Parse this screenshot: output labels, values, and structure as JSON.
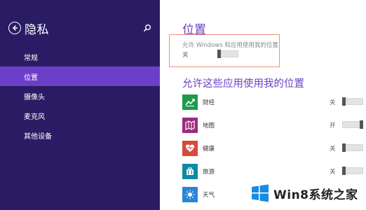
{
  "sidebar": {
    "title": "隐私",
    "items": [
      {
        "label": "常规",
        "active": false
      },
      {
        "label": "位置",
        "active": true
      },
      {
        "label": "摄像头",
        "active": false
      },
      {
        "label": "麦克风",
        "active": false
      },
      {
        "label": "其他设备",
        "active": false
      }
    ]
  },
  "main": {
    "heading": "位置",
    "master_toggle": {
      "description": "允许 Windows 和应用使用我的位置",
      "state": "关",
      "value": false
    },
    "apps_heading": "允许这些应用使用我的位置",
    "apps": [
      {
        "name": "财经",
        "state": "关",
        "value": false,
        "icon": "finance-icon",
        "color": "#1e9b4a"
      },
      {
        "name": "地图",
        "state": "开",
        "value": true,
        "icon": "maps-icon",
        "color": "#9c2b7d"
      },
      {
        "name": "健康",
        "state": "关",
        "value": false,
        "icon": "health-icon",
        "color": "#d94a3c"
      },
      {
        "name": "旅游",
        "state": "关",
        "value": false,
        "icon": "travel-icon",
        "color": "#1189a3"
      },
      {
        "name": "天气",
        "state": "",
        "value": false,
        "icon": "weather-icon",
        "color": "#2b84d6"
      }
    ]
  },
  "watermark": {
    "text": "Win8系统之家"
  },
  "colors": {
    "sidebar_bg": "#2a1c64",
    "accent": "#6b3fc7",
    "highlight_border": "#f0917e"
  }
}
